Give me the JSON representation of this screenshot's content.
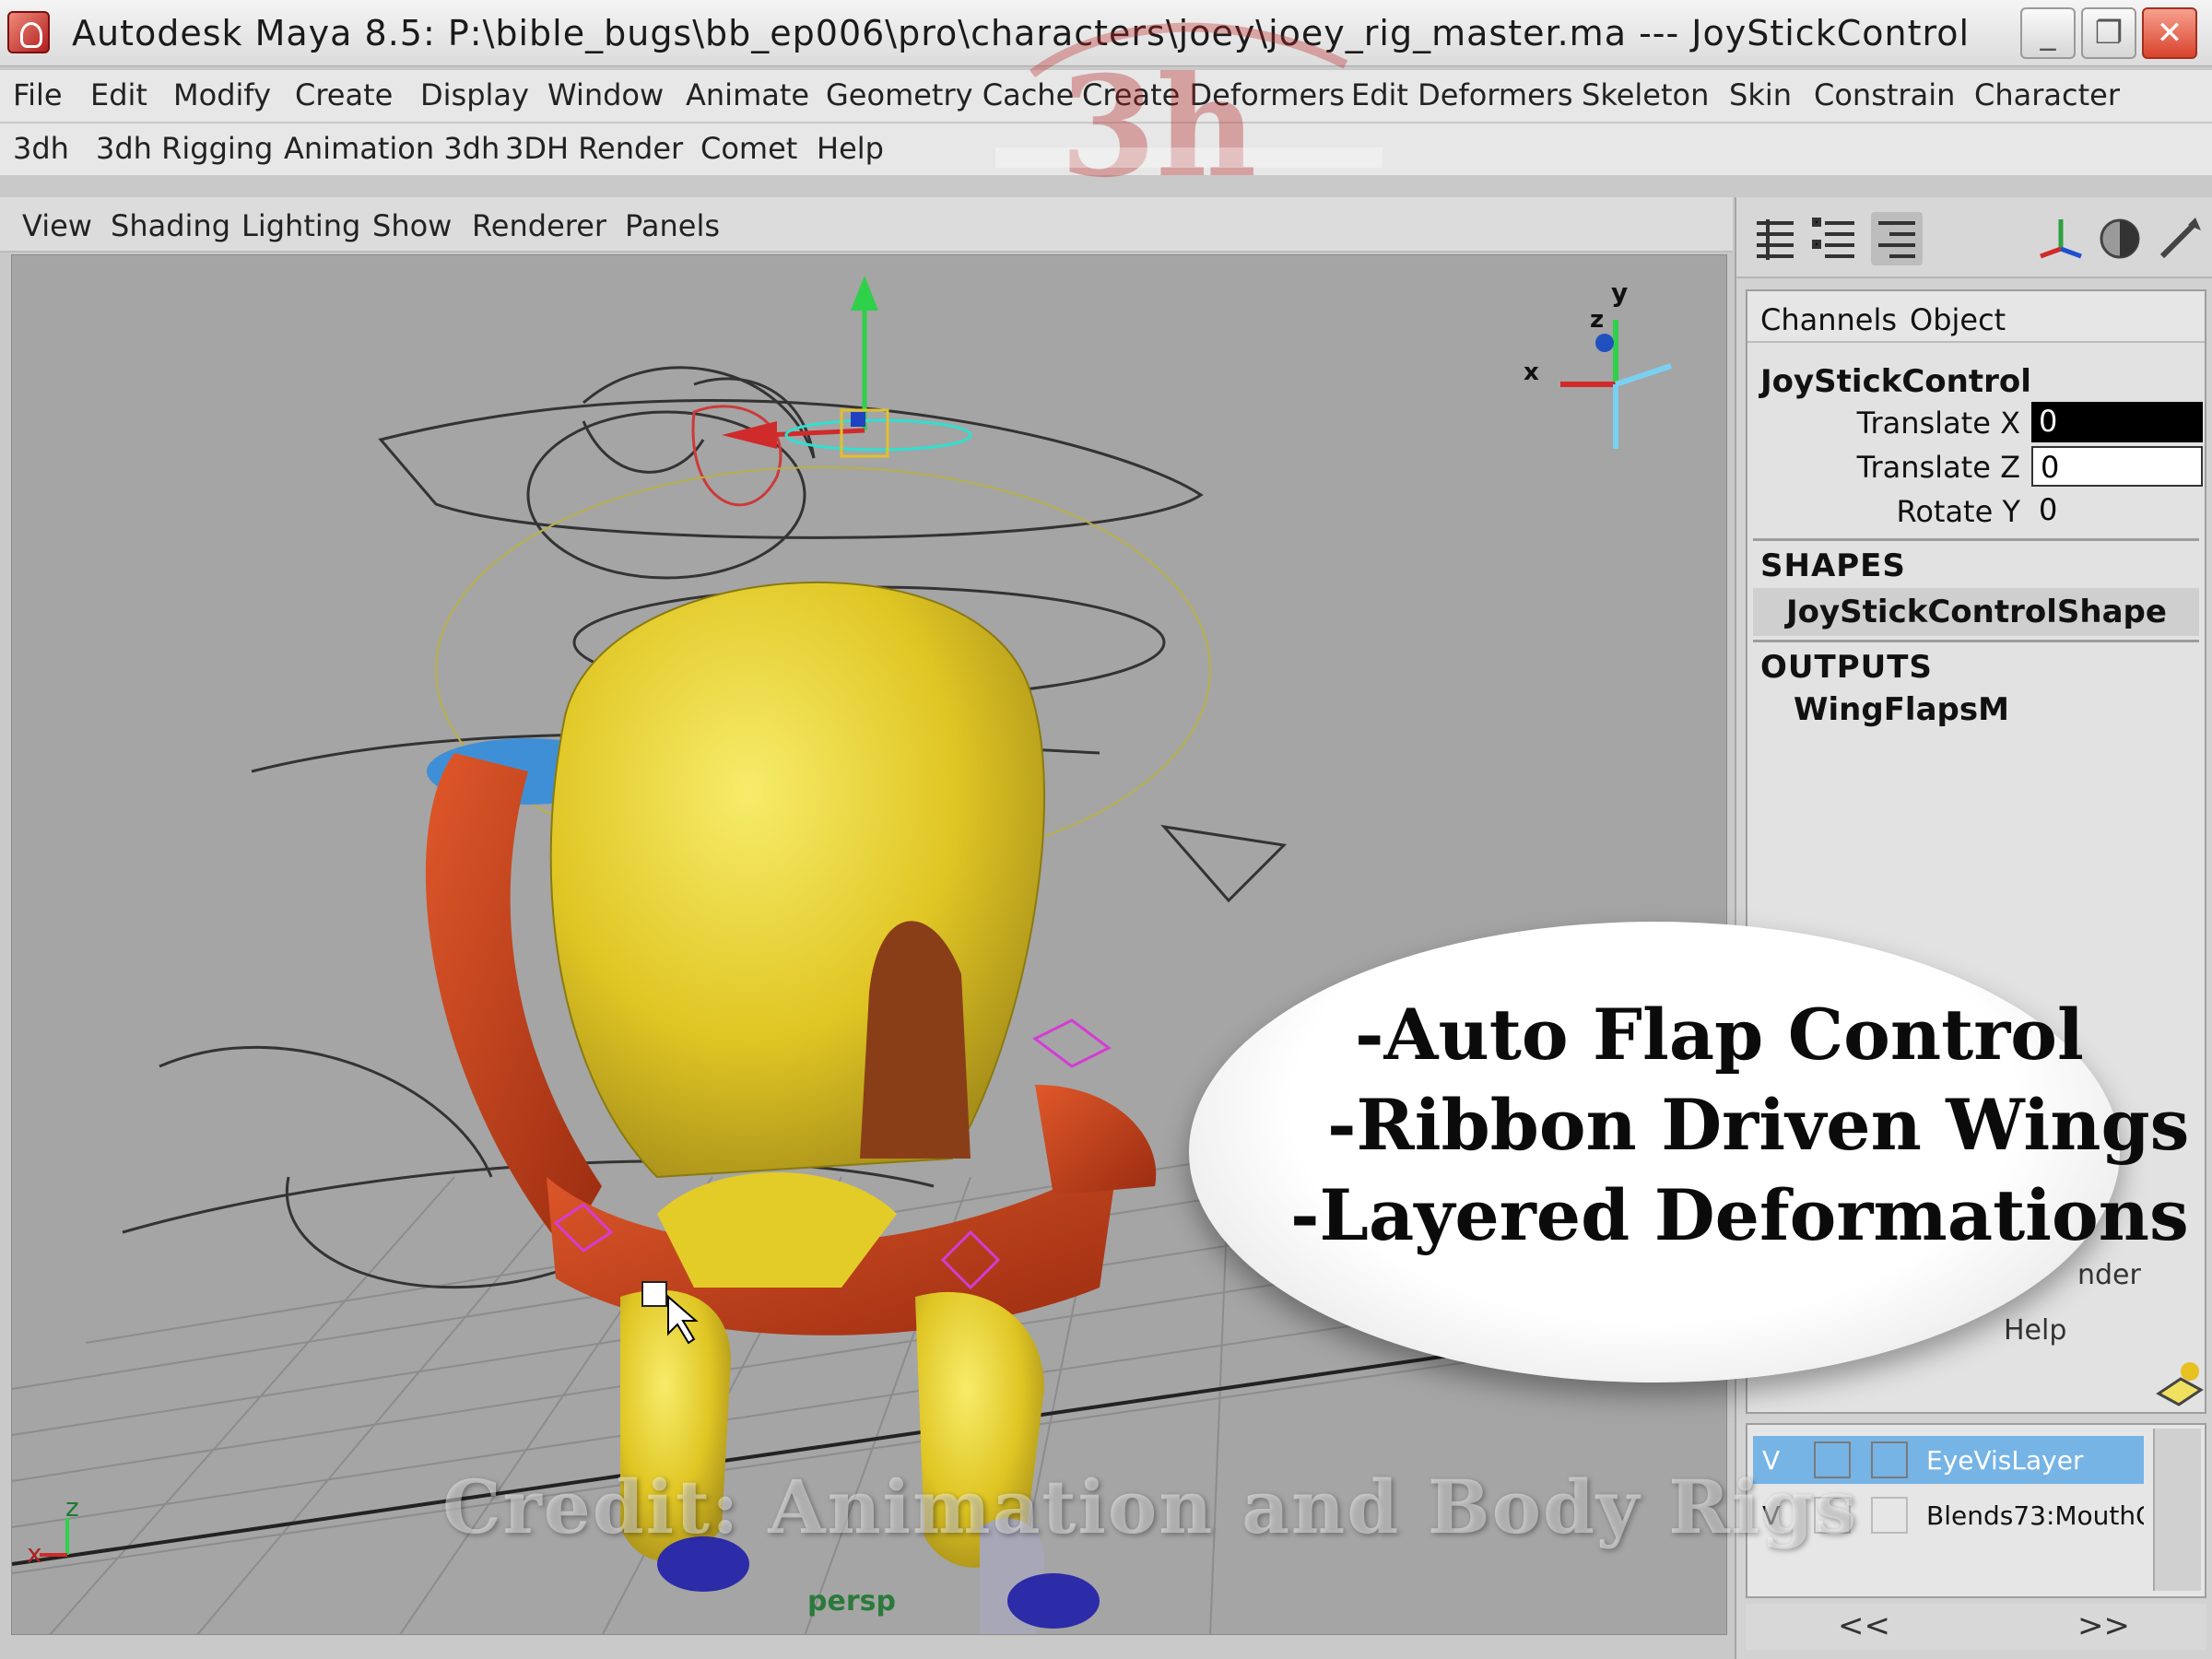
{
  "window": {
    "title": "Autodesk Maya 8.5: P:\\bible_bugs\\bb_ep006\\pro\\characters\\joey\\joey_rig_master.ma   ---   JoyStickControl",
    "minimize": "_",
    "maximize": "❐",
    "close": "✕"
  },
  "menus": {
    "row1": [
      "File",
      "Edit",
      "Modify",
      "Create",
      "Display",
      "Window",
      "Animate",
      "Geometry Cache",
      "Create Deformers",
      "Edit Deformers",
      "Skeleton",
      "Skin",
      "Constrain",
      "Character"
    ],
    "row2": [
      "3dh",
      "3dh Rigging",
      "Animation 3dh",
      "3DH Render",
      "Comet",
      "Help"
    ]
  },
  "viewport": {
    "menu": [
      "View",
      "Shading",
      "Lighting",
      "Show",
      "Renderer",
      "Panels"
    ],
    "camera_label": "persp",
    "axis": {
      "x": "x",
      "y": "y",
      "z": "z"
    }
  },
  "channel_box": {
    "tabs": [
      "Channels",
      "Object"
    ],
    "object_name": "JoyStickControl",
    "attributes": [
      {
        "label": "Translate X",
        "value": "0"
      },
      {
        "label": "Translate Z",
        "value": "0"
      },
      {
        "label": "Rotate Y",
        "value": "0"
      }
    ],
    "shapes_header": "SHAPES",
    "shape_name": "JoyStickControlShape",
    "outputs_header": "OUTPUTS",
    "output_name": "WingFlapsM"
  },
  "layer_editor": {
    "partial_labels": [
      "nder",
      "Help"
    ],
    "layers": [
      {
        "visible": "V",
        "name": "EyeVisLayer",
        "selected": true
      },
      {
        "visible": "V",
        "name": "Blends73:MouthC",
        "selected": false
      }
    ],
    "scroll_left": "<<",
    "scroll_right": ">>"
  },
  "callout": {
    "lines": [
      "-Auto Flap Control",
      "-Ribbon Driven Wings",
      "-Layered Deformations"
    ]
  },
  "credit": "Credit:  Animation and Body Rigs",
  "colors": {
    "viewport_bg": "#a5a5a5",
    "body_yellow": "#e3cf2a",
    "wing_red": "#c2421a",
    "selection_blue": "#76b4e6",
    "manip_green": "#2fd04a"
  }
}
